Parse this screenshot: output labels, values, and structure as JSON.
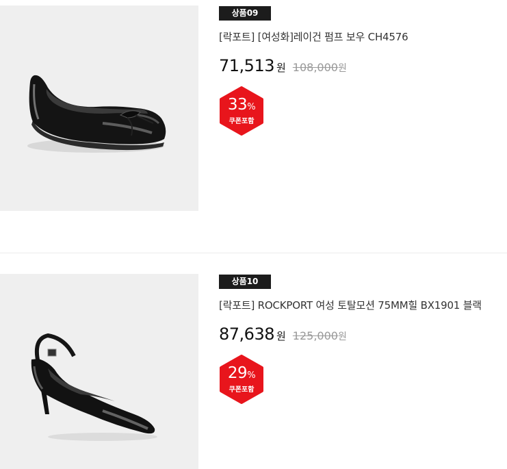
{
  "products": [
    {
      "badge": "상품09",
      "title": "[락포트] [여성화]레이건 펌프 보우 CH4576",
      "price": "71,513",
      "price_unit": "원",
      "original_price": "108,000",
      "original_unit": "원",
      "discount_value": "33",
      "discount_symbol": "%",
      "coupon_label": "쿠폰포함",
      "image": "black patent bow ballet flat"
    },
    {
      "badge": "상품10",
      "title": "[락포트] ROCKPORT 여성 토탈모션 75MM힐 BX1901 블랙",
      "price": "87,638",
      "price_unit": "원",
      "original_price": "125,000",
      "original_unit": "원",
      "discount_value": "29",
      "discount_symbol": "%",
      "coupon_label": "쿠폰포함",
      "image": "black patent slingback heel"
    }
  ],
  "colors": {
    "badge_bg": "#1c1c1c",
    "discount_red": "#e8151c",
    "image_bg": "#efefef",
    "strike_gray": "#999999"
  }
}
